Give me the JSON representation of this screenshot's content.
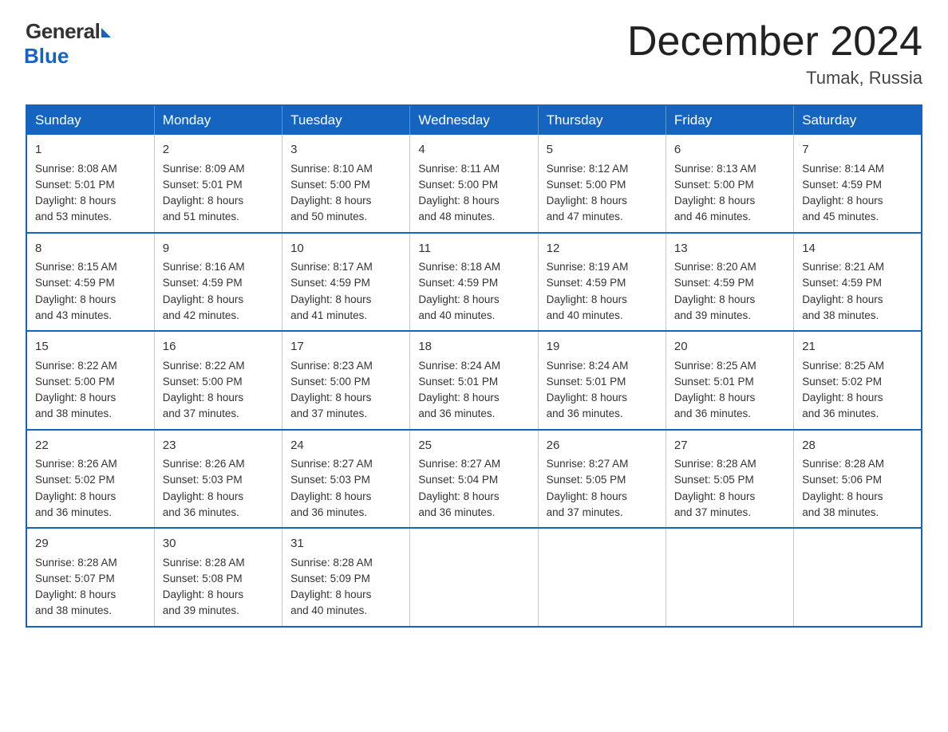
{
  "header": {
    "logo_general": "General",
    "logo_blue": "Blue",
    "month_year": "December 2024",
    "location": "Tumak, Russia"
  },
  "days_of_week": [
    "Sunday",
    "Monday",
    "Tuesday",
    "Wednesday",
    "Thursday",
    "Friday",
    "Saturday"
  ],
  "weeks": [
    [
      {
        "day": "1",
        "sunrise": "8:08 AM",
        "sunset": "5:01 PM",
        "daylight": "8 hours and 53 minutes."
      },
      {
        "day": "2",
        "sunrise": "8:09 AM",
        "sunset": "5:01 PM",
        "daylight": "8 hours and 51 minutes."
      },
      {
        "day": "3",
        "sunrise": "8:10 AM",
        "sunset": "5:00 PM",
        "daylight": "8 hours and 50 minutes."
      },
      {
        "day": "4",
        "sunrise": "8:11 AM",
        "sunset": "5:00 PM",
        "daylight": "8 hours and 48 minutes."
      },
      {
        "day": "5",
        "sunrise": "8:12 AM",
        "sunset": "5:00 PM",
        "daylight": "8 hours and 47 minutes."
      },
      {
        "day": "6",
        "sunrise": "8:13 AM",
        "sunset": "5:00 PM",
        "daylight": "8 hours and 46 minutes."
      },
      {
        "day": "7",
        "sunrise": "8:14 AM",
        "sunset": "4:59 PM",
        "daylight": "8 hours and 45 minutes."
      }
    ],
    [
      {
        "day": "8",
        "sunrise": "8:15 AM",
        "sunset": "4:59 PM",
        "daylight": "8 hours and 43 minutes."
      },
      {
        "day": "9",
        "sunrise": "8:16 AM",
        "sunset": "4:59 PM",
        "daylight": "8 hours and 42 minutes."
      },
      {
        "day": "10",
        "sunrise": "8:17 AM",
        "sunset": "4:59 PM",
        "daylight": "8 hours and 41 minutes."
      },
      {
        "day": "11",
        "sunrise": "8:18 AM",
        "sunset": "4:59 PM",
        "daylight": "8 hours and 40 minutes."
      },
      {
        "day": "12",
        "sunrise": "8:19 AM",
        "sunset": "4:59 PM",
        "daylight": "8 hours and 40 minutes."
      },
      {
        "day": "13",
        "sunrise": "8:20 AM",
        "sunset": "4:59 PM",
        "daylight": "8 hours and 39 minutes."
      },
      {
        "day": "14",
        "sunrise": "8:21 AM",
        "sunset": "4:59 PM",
        "daylight": "8 hours and 38 minutes."
      }
    ],
    [
      {
        "day": "15",
        "sunrise": "8:22 AM",
        "sunset": "5:00 PM",
        "daylight": "8 hours and 38 minutes."
      },
      {
        "day": "16",
        "sunrise": "8:22 AM",
        "sunset": "5:00 PM",
        "daylight": "8 hours and 37 minutes."
      },
      {
        "day": "17",
        "sunrise": "8:23 AM",
        "sunset": "5:00 PM",
        "daylight": "8 hours and 37 minutes."
      },
      {
        "day": "18",
        "sunrise": "8:24 AM",
        "sunset": "5:01 PM",
        "daylight": "8 hours and 36 minutes."
      },
      {
        "day": "19",
        "sunrise": "8:24 AM",
        "sunset": "5:01 PM",
        "daylight": "8 hours and 36 minutes."
      },
      {
        "day": "20",
        "sunrise": "8:25 AM",
        "sunset": "5:01 PM",
        "daylight": "8 hours and 36 minutes."
      },
      {
        "day": "21",
        "sunrise": "8:25 AM",
        "sunset": "5:02 PM",
        "daylight": "8 hours and 36 minutes."
      }
    ],
    [
      {
        "day": "22",
        "sunrise": "8:26 AM",
        "sunset": "5:02 PM",
        "daylight": "8 hours and 36 minutes."
      },
      {
        "day": "23",
        "sunrise": "8:26 AM",
        "sunset": "5:03 PM",
        "daylight": "8 hours and 36 minutes."
      },
      {
        "day": "24",
        "sunrise": "8:27 AM",
        "sunset": "5:03 PM",
        "daylight": "8 hours and 36 minutes."
      },
      {
        "day": "25",
        "sunrise": "8:27 AM",
        "sunset": "5:04 PM",
        "daylight": "8 hours and 36 minutes."
      },
      {
        "day": "26",
        "sunrise": "8:27 AM",
        "sunset": "5:05 PM",
        "daylight": "8 hours and 37 minutes."
      },
      {
        "day": "27",
        "sunrise": "8:28 AM",
        "sunset": "5:05 PM",
        "daylight": "8 hours and 37 minutes."
      },
      {
        "day": "28",
        "sunrise": "8:28 AM",
        "sunset": "5:06 PM",
        "daylight": "8 hours and 38 minutes."
      }
    ],
    [
      {
        "day": "29",
        "sunrise": "8:28 AM",
        "sunset": "5:07 PM",
        "daylight": "8 hours and 38 minutes."
      },
      {
        "day": "30",
        "sunrise": "8:28 AM",
        "sunset": "5:08 PM",
        "daylight": "8 hours and 39 minutes."
      },
      {
        "day": "31",
        "sunrise": "8:28 AM",
        "sunset": "5:09 PM",
        "daylight": "8 hours and 40 minutes."
      },
      null,
      null,
      null,
      null
    ]
  ],
  "labels": {
    "sunrise": "Sunrise:",
    "sunset": "Sunset:",
    "daylight": "Daylight:"
  }
}
